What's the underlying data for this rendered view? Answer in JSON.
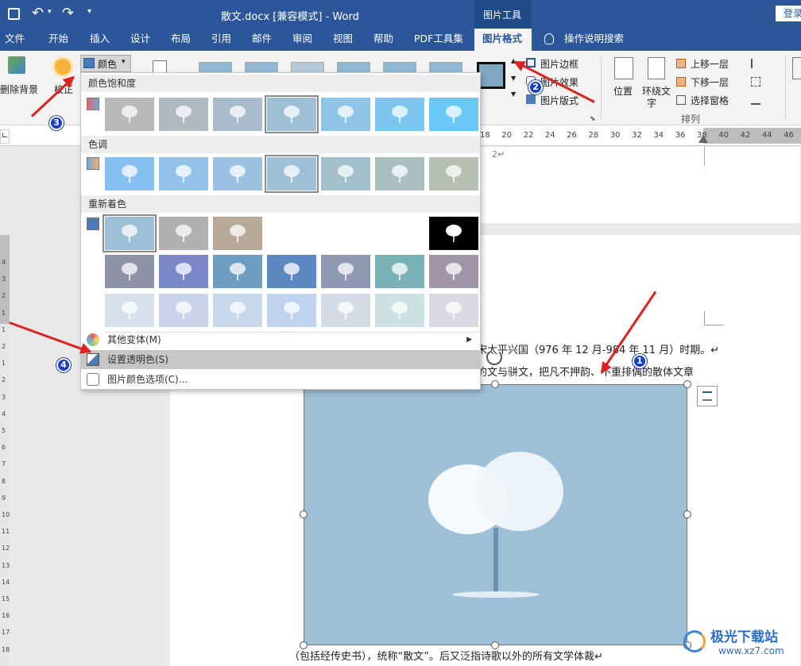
{
  "titlebar": {
    "doc_title": "散文.docx [兼容模式]  -  Word",
    "context_tab": "图片工具",
    "login": "登录"
  },
  "tabs": [
    "文件",
    "开始",
    "插入",
    "设计",
    "布局",
    "引用",
    "邮件",
    "审阅",
    "视图",
    "帮助",
    "PDF工具集",
    "图片格式",
    "操作说明搜索"
  ],
  "ribbon": {
    "remove_bg": "删除背景",
    "corrections": "校正",
    "color": "颜色",
    "picture_border": "图片边框",
    "picture_effects": "图片效果",
    "picture_layout": "图片版式",
    "position": "位置",
    "wrap_text_1": "环绕文",
    "wrap_text_2": "字",
    "bring_forward": "上移一层",
    "send_backward": "下移一层",
    "selection_pane": "选择窗格",
    "arrange_group": "排列"
  },
  "ruler_numbers": [
    "18",
    "20",
    "22",
    "24",
    "26",
    "28",
    "30",
    "32",
    "34",
    "36",
    "38",
    "40",
    "42",
    "44",
    "46"
  ],
  "left_ruler_numbers": [
    "4",
    "3",
    "2",
    "1",
    "1",
    "2",
    "1",
    "2",
    "3",
    "4",
    "5",
    "6",
    "7",
    "8",
    "9",
    "10",
    "11",
    "12",
    "13",
    "14",
    "15",
    "16",
    "17",
    "18"
  ],
  "color_menu": {
    "saturation_header": "颜色饱和度",
    "tone_header": "色调",
    "recolor_header": "重新着色",
    "more_variations": "其他变体(M)",
    "set_transparent": "设置透明色(S)",
    "color_options": "图片颜色选项(C)..."
  },
  "document": {
    "page_num_mark": "2↵",
    "line1": "宋太平兴国（976 年 12 月-984 年 11 月）时期。↵",
    "line2": "的文与骈文，把凡不押韵、不重排偶的散体文章",
    "line3": "（包括经传史书），统称“散文”。后又泛指诗歌以外的所有文学体裁↵"
  },
  "annotations": [
    "1",
    "2",
    "3",
    "4"
  ],
  "watermark": {
    "brand": "极光下载站",
    "url": "www.xz7.com"
  },
  "colors": {
    "word_blue": "#2b579a",
    "arrow_red": "#e0211d",
    "badge_blue": "#1a3fc4",
    "picture_bg": "#9ec0d6"
  }
}
